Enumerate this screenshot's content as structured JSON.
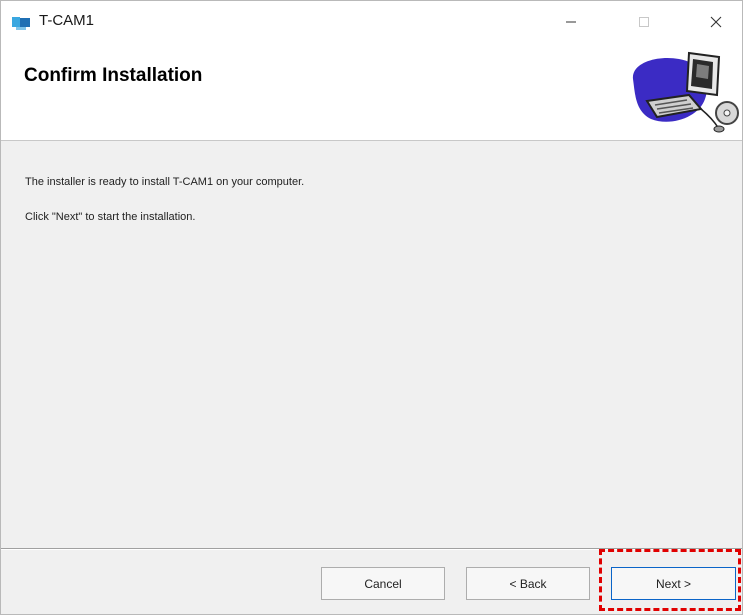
{
  "window": {
    "title": "T-CAM1",
    "icon": "installer-app-icon"
  },
  "header": {
    "title": "Confirm Installation",
    "graphic": "computer-setup-graphic"
  },
  "content": {
    "message_1": "The installer is ready to install T-CAM1 on your computer.",
    "message_2": "Click \"Next\" to start the installation."
  },
  "buttons": {
    "cancel": "Cancel",
    "back": "< Back",
    "next": "Next >"
  },
  "colors": {
    "highlight": "#e00000",
    "next_border": "#0a64c8",
    "dialog_bg": "#f0f0f0"
  }
}
